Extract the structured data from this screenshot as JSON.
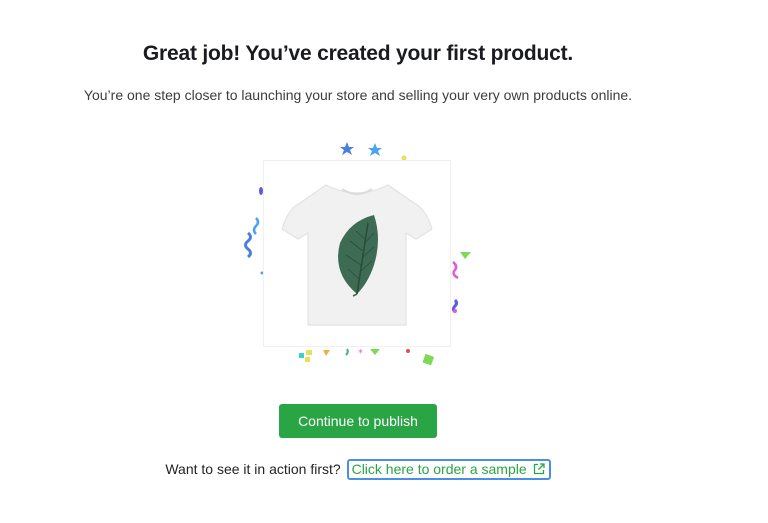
{
  "heading": "Great job! You’ve created your first product.",
  "subheading": "You’re one step closer to launching your store and selling your very own products online.",
  "product": {
    "image_icon": "tshirt-leaf-icon"
  },
  "actions": {
    "publish_label": "Continue to publish",
    "sample_prompt": "Want to see it in action first?",
    "sample_link_label": "Click here to order a sample",
    "sample_link_icon": "external-link-icon"
  },
  "colors": {
    "primary": "#29a545",
    "focus_ring": "#4a90e2",
    "leaf": "#3d6b54"
  }
}
